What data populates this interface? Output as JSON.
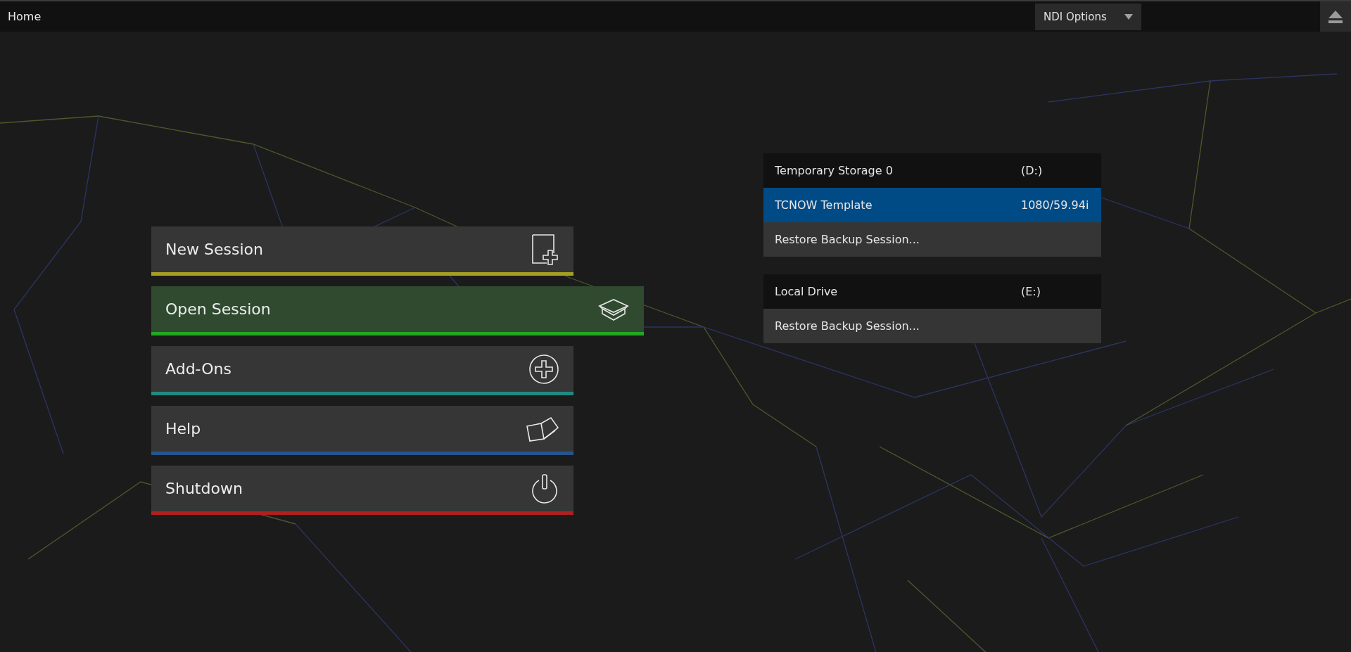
{
  "top_bar": {
    "title": "Home",
    "ndi_dropdown": {
      "label": "NDI Options"
    }
  },
  "menu": [
    {
      "kind": "new",
      "label": "New Session",
      "color": "#a6a021",
      "selected": false
    },
    {
      "kind": "open",
      "label": "Open Session",
      "color": "#22a822",
      "selected": true
    },
    {
      "kind": "addons",
      "label": "Add-Ons",
      "color": "#1f8a80",
      "selected": false
    },
    {
      "kind": "help",
      "label": "Help",
      "color": "#24558f",
      "selected": false
    },
    {
      "kind": "shutdown",
      "label": "Shutdown",
      "color": "#b0201e",
      "selected": false
    }
  ],
  "drives": [
    {
      "name": "Temporary Storage 0",
      "letter": "(D:)",
      "sessions": [
        {
          "name": "TCNOW Template",
          "format": "1080/59.94i",
          "selected": true
        }
      ],
      "restore": "Restore Backup Session..."
    },
    {
      "name": "Local Drive",
      "letter": "(E:)",
      "restore": "Restore Backup Session..."
    }
  ]
}
